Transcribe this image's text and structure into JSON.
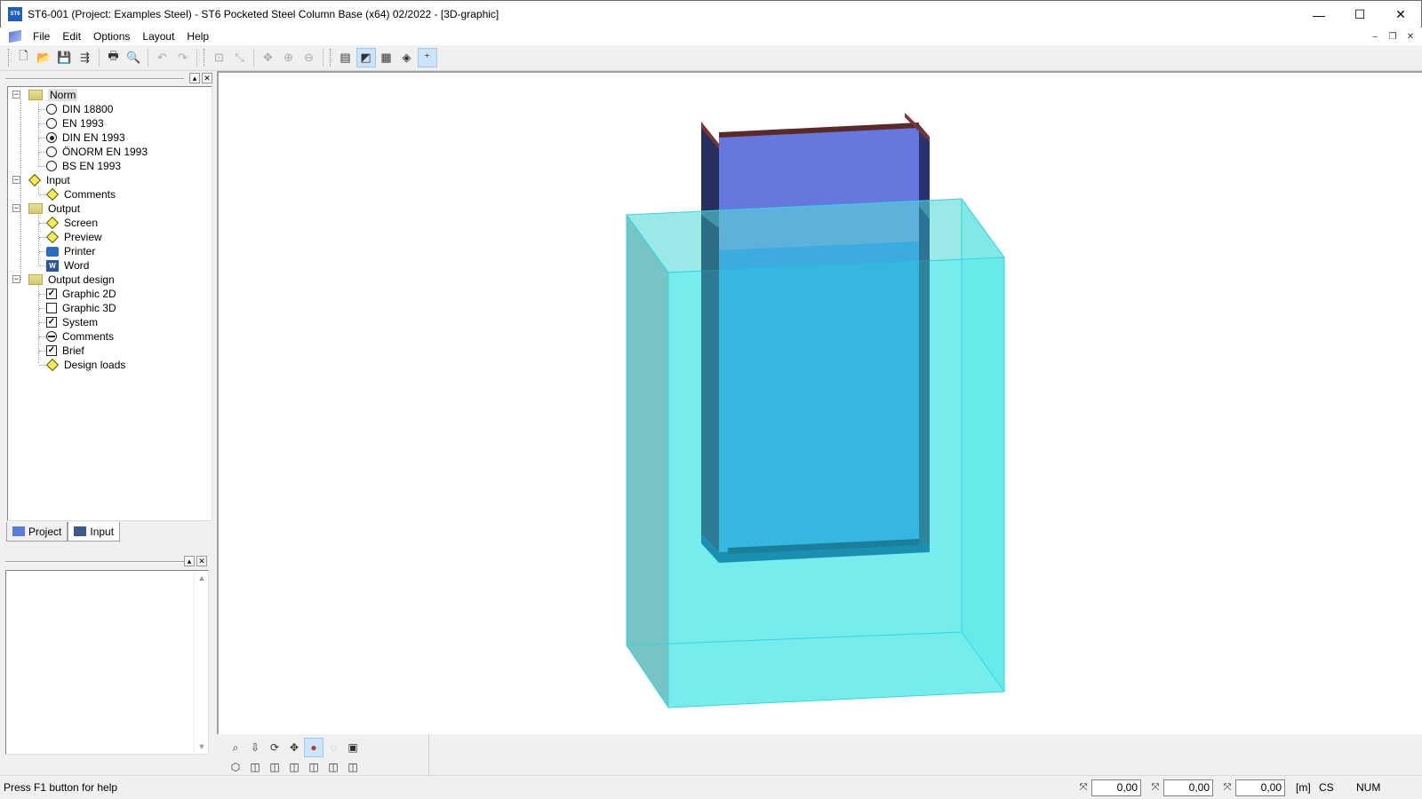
{
  "window": {
    "title": "ST6-001 (Project: Examples Steel) - ST6 Pocketed Steel Column Base (x64) 02/2022 - [3D-graphic]",
    "app_badge": "ST6",
    "controls": {
      "minimize": "—",
      "maximize": "☐",
      "close": "✕"
    }
  },
  "menu": {
    "items": [
      "File",
      "Edit",
      "Options",
      "Layout",
      "Help"
    ],
    "mdi": {
      "minimize": "–",
      "restore": "❐",
      "close": "✕"
    }
  },
  "toolbar": {
    "buttons": [
      {
        "icon": "new-file-icon",
        "glyph": "🗋"
      },
      {
        "icon": "open-folder-icon",
        "glyph": "📂"
      },
      {
        "icon": "save-icon",
        "glyph": "💾"
      },
      {
        "icon": "export-icon",
        "glyph": "⇶"
      },
      {
        "icon": "print-icon",
        "glyph": "🖶"
      },
      {
        "icon": "print-preview-icon",
        "glyph": "🔍"
      },
      {
        "icon": "undo-icon",
        "glyph": "↶"
      },
      {
        "icon": "redo-icon",
        "glyph": "↷"
      },
      {
        "icon": "zoom-window-icon",
        "glyph": "⊡"
      },
      {
        "icon": "zoom-all-icon",
        "glyph": "⤡"
      },
      {
        "icon": "pan-icon",
        "glyph": "✥"
      },
      {
        "icon": "zoom-in-icon",
        "glyph": "⊕"
      },
      {
        "icon": "zoom-out-icon",
        "glyph": "⊖"
      },
      {
        "icon": "input-view-icon",
        "glyph": "▤"
      },
      {
        "icon": "3d-view-icon",
        "glyph": "◩"
      },
      {
        "icon": "document-icon",
        "glyph": "▦"
      },
      {
        "icon": "output-icon",
        "glyph": "◈"
      },
      {
        "icon": "axis-toggle-icon",
        "glyph": "⁺"
      }
    ]
  },
  "tree": {
    "groups": [
      {
        "label": "Norm",
        "icon": "folder-icon",
        "selected": true,
        "children": [
          {
            "label": "DIN 18800",
            "icon": "radio-icon",
            "checked": false
          },
          {
            "label": "EN 1993",
            "icon": "radio-icon",
            "checked": false
          },
          {
            "label": "DIN EN 1993",
            "icon": "radio-icon",
            "checked": true
          },
          {
            "label": "ÖNORM EN 1993",
            "icon": "radio-icon",
            "checked": false
          },
          {
            "label": "BS EN 1993",
            "icon": "radio-icon",
            "checked": false
          }
        ]
      },
      {
        "label": "Input",
        "icon": "diamond-icon",
        "children": [
          {
            "label": "Comments",
            "icon": "diamond-icon"
          }
        ]
      },
      {
        "label": "Output",
        "icon": "folder-icon",
        "children": [
          {
            "label": "Screen",
            "icon": "diamond-icon"
          },
          {
            "label": "Preview",
            "icon": "diamond-icon"
          },
          {
            "label": "Printer",
            "icon": "printer-icon"
          },
          {
            "label": "Word",
            "icon": "word-icon"
          }
        ]
      },
      {
        "label": "Output design",
        "icon": "folder-icon",
        "children": [
          {
            "label": "Graphic 2D",
            "icon": "checkbox-icon",
            "checked": true
          },
          {
            "label": "Graphic 3D",
            "icon": "checkbox-icon",
            "checked": false
          },
          {
            "label": "System",
            "icon": "checkbox-icon",
            "checked": true
          },
          {
            "label": "Comments",
            "icon": "indeterminate-icon"
          },
          {
            "label": "Brief",
            "icon": "checkbox-icon",
            "checked": true
          },
          {
            "label": "Design loads",
            "icon": "diamond-icon"
          }
        ]
      }
    ]
  },
  "tabs": {
    "project": "Project",
    "input": "Input",
    "active": "input"
  },
  "status": {
    "help": "Press F1 button for help",
    "x": "0,00",
    "y": "0,00",
    "z": "0,00",
    "unit": "[m]",
    "cs": "CS",
    "num": "NUM"
  },
  "colors": {
    "concrete_fill": "#49e6e6",
    "column_web": "#6677dd",
    "column_flange_top": "#7a3535",
    "accent": "#cce4f7"
  }
}
